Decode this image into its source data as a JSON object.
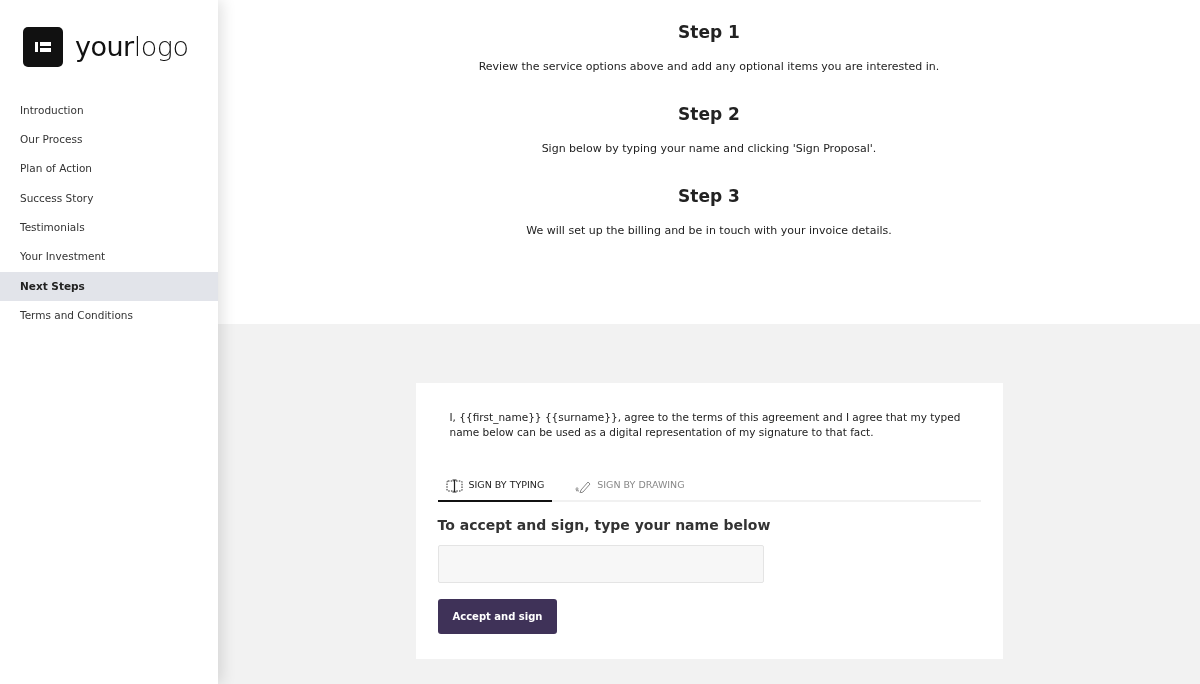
{
  "logo": {
    "text": "**your**logo"
  },
  "sidebar": {
    "items": [
      {
        "label": "Introduction",
        "selected": false
      },
      {
        "label": "Our Process",
        "selected": false
      },
      {
        "label": "Plan of Action",
        "selected": false
      },
      {
        "label": "Success Story",
        "selected": false
      },
      {
        "label": "Testimonials",
        "selected": false
      },
      {
        "label": "Your Investment",
        "selected": false
      },
      {
        "label": "Next Steps",
        "selected": true
      },
      {
        "label": "Terms and Conditions",
        "selected": false
      }
    ]
  },
  "steps": [
    {
      "title": "Step 1",
      "text": "Review the service options above and add any optional items you are interested in."
    },
    {
      "title": "Step 2",
      "text": "Sign below by typing your name and clicking 'Sign Proposal'."
    },
    {
      "title": "Step 3",
      "text": "We will set up the billing and be in touch with your invoice details."
    }
  ],
  "signature": {
    "agreement": "I, {{first_name}} {{surname}}, agree to the terms of this agreement and I agree that my typed name below can be used as a digital representation of my signature to that fact.",
    "tabs": [
      {
        "label": "SIGN BY TYPING",
        "kind": "typing",
        "selected": true
      },
      {
        "label": "SIGN BY DRAWING",
        "kind": "drawing",
        "selected": false
      }
    ],
    "prompt": "To accept and sign, type your name below",
    "button": "Accept and sign"
  }
}
